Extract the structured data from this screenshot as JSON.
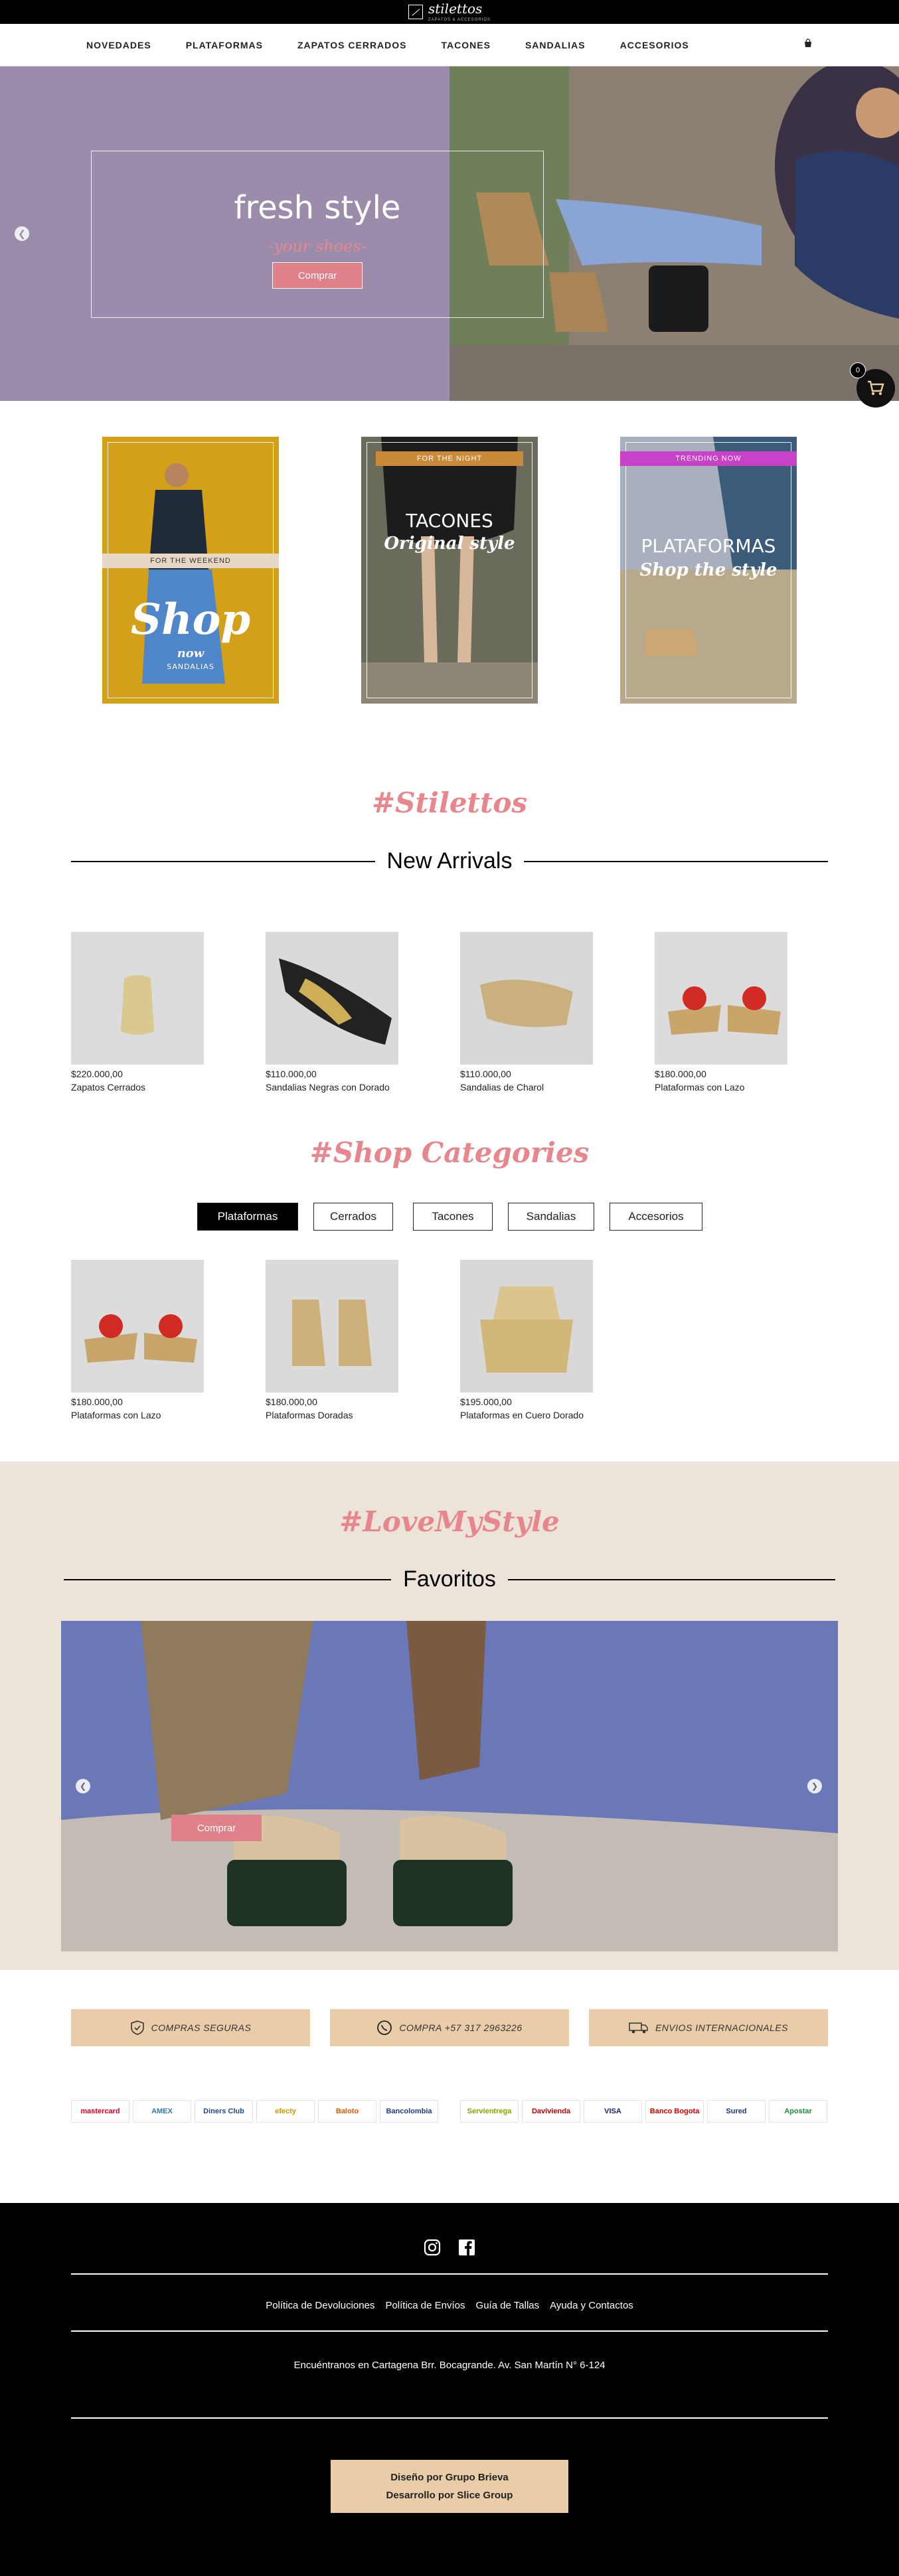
{
  "brand": {
    "name": "stilettos",
    "tagline": "ZAPATOS & ACCESORIOS"
  },
  "nav": {
    "items": [
      {
        "label": "NOVEDADES"
      },
      {
        "label": "PLATAFORMAS"
      },
      {
        "label": "ZAPATOS CERRADOS"
      },
      {
        "label": "TACONES"
      },
      {
        "label": "SANDALIAS"
      },
      {
        "label": "ACCESORIOS"
      }
    ]
  },
  "hero": {
    "title": "fresh style",
    "subtitle": "-your shoes-",
    "button": "Comprar"
  },
  "cart": {
    "count": "0"
  },
  "promos": [
    {
      "tag": "FOR THE WEEKEND",
      "title": "Shop",
      "script": "now",
      "sub": "SANDALIAS"
    },
    {
      "tag": "FOR THE NIGHT",
      "title": "TACONES",
      "script": "Original style"
    },
    {
      "tag": "TRENDING NOW",
      "title": "PLATAFORMAS",
      "script": "Shop the style"
    }
  ],
  "colors": {
    "accent_pink": "#e8868e",
    "hero_purple": "#9b8cac",
    "sand": "#e8cda8",
    "beige": "#ece3d9"
  },
  "new_arrivals": {
    "script": "#Stilettos",
    "title": "New Arrivals",
    "products": [
      {
        "price": "$220.000,00",
        "name": "Zapatos Cerrados"
      },
      {
        "price": "$110.000,00",
        "name": "Sandalias Negras con Dorado"
      },
      {
        "price": "$110.000,00",
        "name": "Sandalias de Charol"
      },
      {
        "price": "$180.000,00",
        "name": "Plataformas con Lazo"
      }
    ]
  },
  "categories": {
    "script": "#Shop Categories",
    "tabs": [
      {
        "label": "Plataformas"
      },
      {
        "label": "Cerrados"
      },
      {
        "label": "Tacones"
      },
      {
        "label": "Sandalias"
      },
      {
        "label": "Accesorios"
      }
    ],
    "products": [
      {
        "price": "$180.000,00",
        "name": "Plataformas con Lazo"
      },
      {
        "price": "$180.000,00",
        "name": "Plataformas Doradas"
      },
      {
        "price": "$195.000,00",
        "name": "Plataformas en Cuero Dorado"
      }
    ]
  },
  "favorites": {
    "script": "#LoveMyStyle",
    "title": "Favoritos",
    "button": "Comprar"
  },
  "trust": [
    {
      "label": "COMPRAS SEGURAS"
    },
    {
      "label": "COMPRA +57 317 2963226"
    },
    {
      "label": "ENVIOS INTERNACIONALES"
    }
  ],
  "payments": [
    "mastercard",
    "AMEX",
    "Diners Club",
    "efecty",
    "Baloto",
    "Bancolombia",
    "Servientrega",
    "Davivienda",
    "VISA",
    "Banco Bogota",
    "Sured",
    "Apostar"
  ],
  "footer": {
    "links": [
      {
        "label": "Política de Devoluciones"
      },
      {
        "label": "Política de Envíos"
      },
      {
        "label": "Guía de Tallas"
      },
      {
        "label": "Ayuda y Contactos"
      }
    ],
    "address": "Encuéntranos en Cartagena Brr. Bocagrande. Av. San Martín N° 6-124",
    "credit1": "Diseño por Grupo Brieva",
    "credit2": "Desarrollo por Slice Group"
  }
}
